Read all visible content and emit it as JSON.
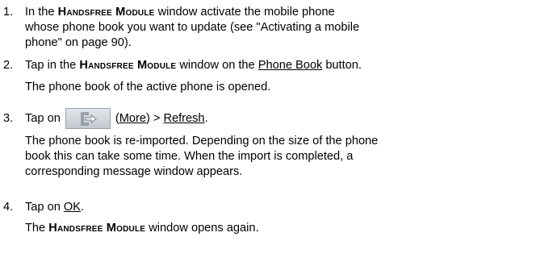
{
  "steps": [
    {
      "number": "1.",
      "line1_pre": "In the ",
      "line1_bold": "Handsfree Module",
      "line1_post": " window activate the mobile phone",
      "line2": "whose phone book you want to update (see \"Activating a mobile",
      "line3": "phone\" on page 90)."
    },
    {
      "number": "2.",
      "pre": "Tap in the ",
      "bold": "Handsfree Module",
      "mid": " window on the ",
      "link": "Phone Book",
      "post": " button.",
      "result": "The phone book of the active phone is opened."
    },
    {
      "number": "3.",
      "pre": "Tap on",
      "icon": "more-icon",
      "paren_open": "(",
      "link1": "More",
      "paren_close": ") > ",
      "link2": "Refresh",
      "post": ".",
      "result_line1": "The phone book is re-imported. Depending on the size of the phone",
      "result_line2": "book this can take some time. When the import is completed, a",
      "result_line3": "corresponding message window appears."
    },
    {
      "number": "4.",
      "pre": "Tap on ",
      "link": "OK",
      "post": ".",
      "result_pre": "The ",
      "result_bold": "Handsfree Module",
      "result_post": " window opens again."
    }
  ]
}
